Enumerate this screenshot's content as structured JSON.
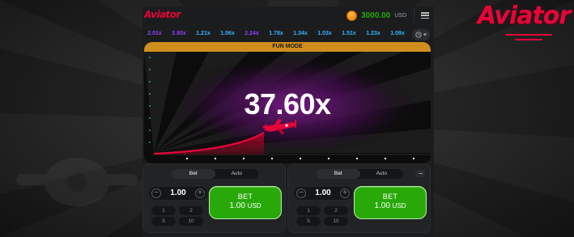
{
  "brand": {
    "name": "Aviator",
    "color": "#e50539"
  },
  "header": {
    "balance": "3000.00",
    "currency": "USD",
    "balance_icon": "coin-icon",
    "menu_icon": "menu-icon"
  },
  "history": {
    "multipliers": [
      {
        "value": "2.01x",
        "color": "#913ef8"
      },
      {
        "value": "2.80x",
        "color": "#913ef8"
      },
      {
        "value": "1.21x",
        "color": "#34b4ff"
      },
      {
        "value": "1.06x",
        "color": "#34b4ff"
      },
      {
        "value": "2.24x",
        "color": "#913ef8"
      },
      {
        "value": "1.78x",
        "color": "#34b4ff"
      },
      {
        "value": "1.34x",
        "color": "#34b4ff"
      },
      {
        "value": "1.03x",
        "color": "#34b4ff"
      },
      {
        "value": "1.51x",
        "color": "#34b4ff"
      },
      {
        "value": "1.23x",
        "color": "#34b4ff"
      },
      {
        "value": "1.09x",
        "color": "#34b4ff"
      }
    ],
    "history_icon": "history-icon"
  },
  "game": {
    "mode_banner": "FUN MODE",
    "multiplier": "37.60x",
    "plane_icon": "airplane-icon"
  },
  "bet_panels": [
    {
      "tabs": [
        "Bet",
        "Auto"
      ],
      "active_tab": "Bet",
      "amount": "1.00",
      "quick_amounts": [
        "1",
        "2",
        "5",
        "10"
      ],
      "bet_label": "BET",
      "bet_amount": "1.00",
      "bet_currency": "USD"
    },
    {
      "tabs": [
        "Bet",
        "Auto"
      ],
      "active_tab": "Bet",
      "amount": "1.00",
      "quick_amounts": [
        "1",
        "2",
        "5",
        "10"
      ],
      "bet_label": "BET",
      "bet_amount": "1.00",
      "bet_currency": "USD"
    }
  ],
  "colors": {
    "accent_green": "#28a909",
    "fun_mode": "#d08e1c",
    "curve_red": "#e50539"
  }
}
